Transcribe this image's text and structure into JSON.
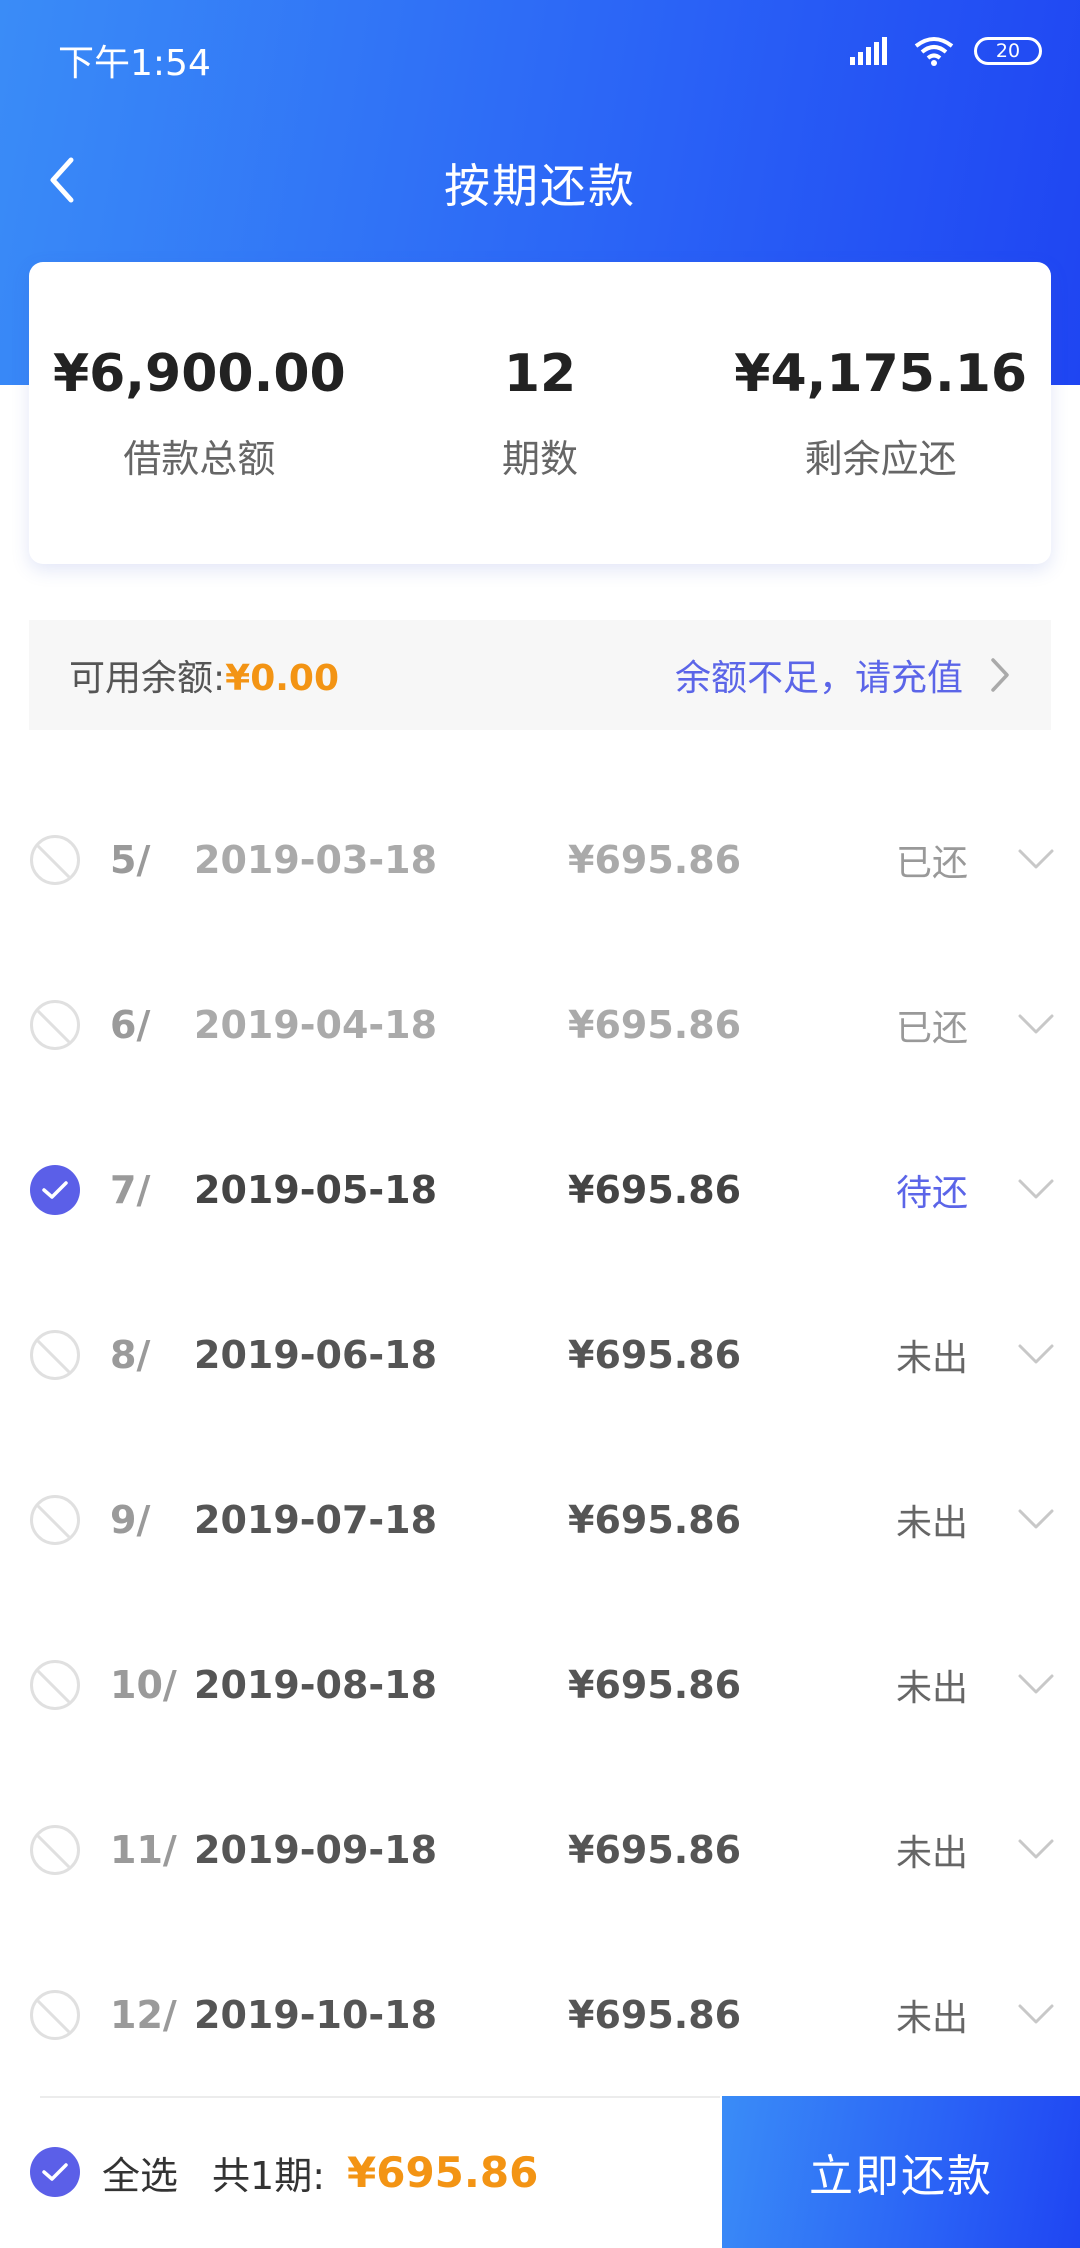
{
  "status_bar": {
    "time": "下午1:54",
    "battery": "20"
  },
  "header": {
    "title": "按期还款"
  },
  "summary": [
    {
      "value": "¥6,900.00",
      "label": "借款总额"
    },
    {
      "value": "12",
      "label": "期数"
    },
    {
      "value": "¥4,175.16",
      "label": "剩余应还"
    }
  ],
  "balance": {
    "label": "可用余额:",
    "amount": "¥0.00",
    "recharge_text": "余额不足，请充值"
  },
  "installments": [
    {
      "period": "5/",
      "date": "2019-03-18",
      "amount": "¥695.86",
      "status": "已还",
      "state": "paid"
    },
    {
      "period": "6/",
      "date": "2019-04-18",
      "amount": "¥695.86",
      "status": "已还",
      "state": "paid"
    },
    {
      "period": "7/",
      "date": "2019-05-18",
      "amount": "¥695.86",
      "status": "待还",
      "state": "due"
    },
    {
      "period": "8/",
      "date": "2019-06-18",
      "amount": "¥695.86",
      "status": "未出",
      "state": "pending"
    },
    {
      "period": "9/",
      "date": "2019-07-18",
      "amount": "¥695.86",
      "status": "未出",
      "state": "pending"
    },
    {
      "period": "10/",
      "date": "2019-08-18",
      "amount": "¥695.86",
      "status": "未出",
      "state": "pending"
    },
    {
      "period": "11/",
      "date": "2019-09-18",
      "amount": "¥695.86",
      "status": "未出",
      "state": "pending"
    },
    {
      "period": "12/",
      "date": "2019-10-18",
      "amount": "¥695.86",
      "status": "未出",
      "state": "pending"
    }
  ],
  "footer": {
    "select_all": "全选",
    "count_label": "共1期:",
    "total": "¥695.86",
    "pay_button": "立即还款"
  },
  "colors": {
    "brand_blue": "#2a62f6",
    "accent_orange": "#f39414",
    "link_purple": "#5b65e8"
  }
}
